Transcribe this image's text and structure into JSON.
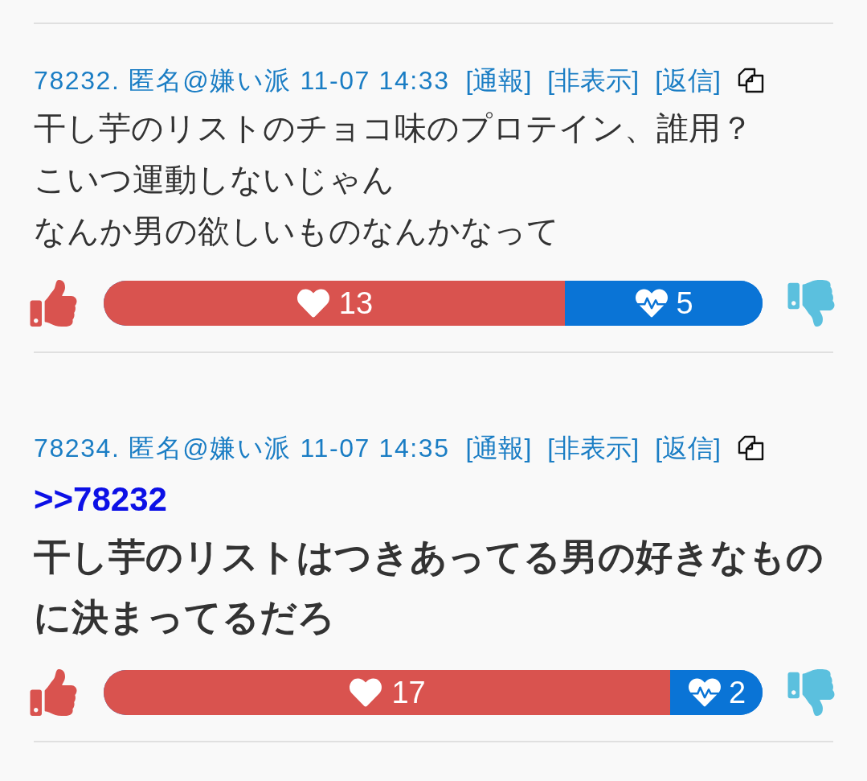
{
  "posts": [
    {
      "meta": "78232. 匿名@嫌い派 11-07 14:33",
      "actions": [
        "[通報]",
        "[非表示]",
        "[返信]"
      ],
      "bold": false,
      "lines": [
        "干し芋のリストのチョコ味のプロテイン、誰用？",
        "こいつ運動しないじゃん",
        "なんか男の欲しいものなんかなって"
      ],
      "likes": "13",
      "dislikes": "5",
      "level": 0.7
    },
    {
      "meta": "78234. 匿名@嫌い派 11-07 14:35",
      "actions": [
        "[通報]",
        "[非表示]",
        "[返信]"
      ],
      "reply_link": ">>78232",
      "bold": true,
      "lines": [
        "干し芋のリストはつきあってる男の好きなもの",
        "に決まってるだろ"
      ],
      "likes": "17",
      "dislikes": "2",
      "level": 0.86
    }
  ]
}
